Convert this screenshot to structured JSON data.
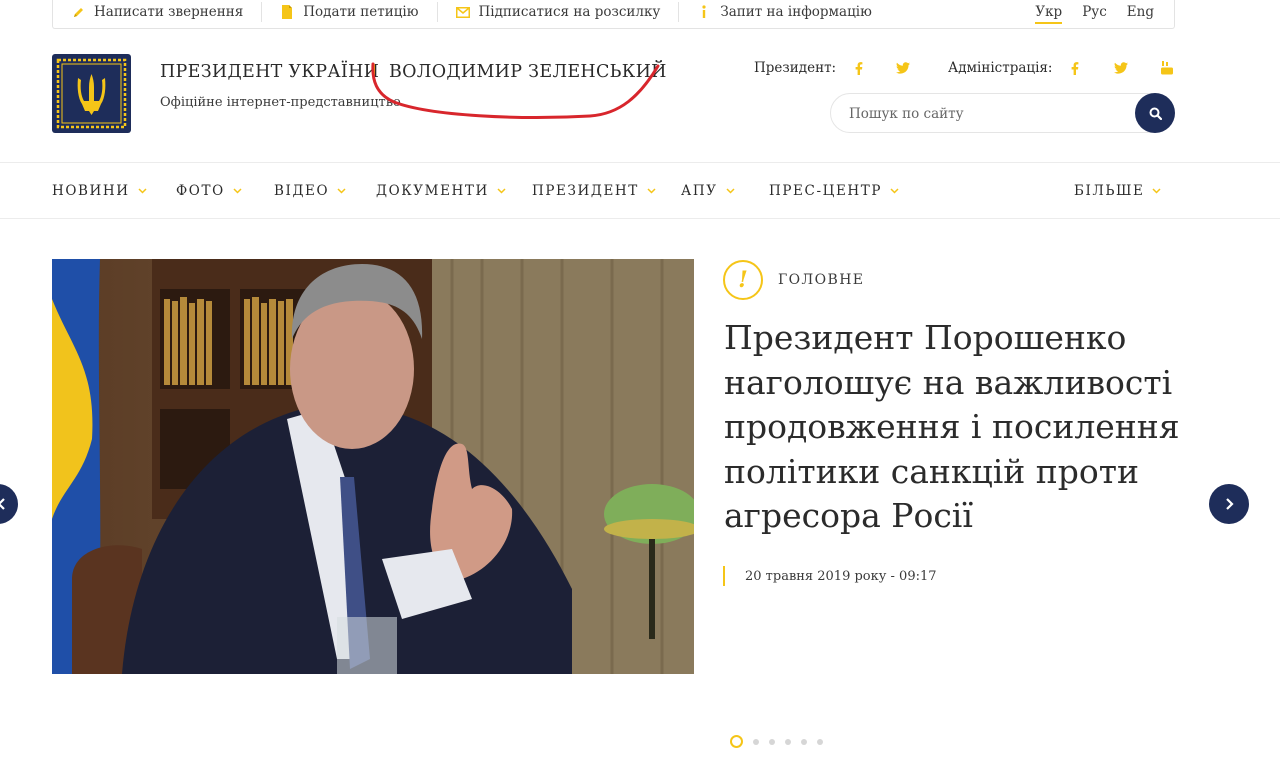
{
  "topbar": {
    "links": [
      {
        "label": "Написати звернення",
        "icon": "pencil-icon"
      },
      {
        "label": "Подати петицію",
        "icon": "document-icon"
      },
      {
        "label": "Підписатися на розсилку",
        "icon": "envelope-icon"
      },
      {
        "label": "Запит на інформацію",
        "icon": "info-icon"
      }
    ],
    "languages": [
      "Укр",
      "Рус",
      "Eng"
    ],
    "active_language": "Укр"
  },
  "header": {
    "title": "ПРЕЗИДЕНТ УКРАЇНИ",
    "name": "ВОЛОДИМИР ЗЕЛЕНСЬКИЙ",
    "subtitle": "Офіційне інтернет-представництво",
    "emblem": "trident-emblem-icon",
    "social_president_label": "Президент:",
    "social_president": [
      "facebook-icon",
      "twitter-icon"
    ],
    "social_admin_label": "Адміністрація:",
    "social_admin": [
      "facebook-icon",
      "twitter-icon",
      "youtube-icon"
    ],
    "search_placeholder": "Пошук по сайту"
  },
  "nav": {
    "items": [
      "НОВИНИ",
      "ФОТО",
      "ВІДЕО",
      "ДОКУМЕНТИ",
      "ПРЕЗИДЕНТ",
      "АПУ",
      "ПРЕС-ЦЕНТР"
    ],
    "more": "БІЛЬШЕ"
  },
  "hero": {
    "category": "ГОЛОВНЕ",
    "headline": "Президент Порошенко наголошує на важливості продовження і посилення політики санкцій проти агресора Росії",
    "date": "20 травня 2019 року - 09:17",
    "slides_total": 6,
    "active_slide": 1
  },
  "colors": {
    "accent": "#f5c518",
    "navy": "#1e2d5a",
    "annotation": "#d8262c"
  }
}
